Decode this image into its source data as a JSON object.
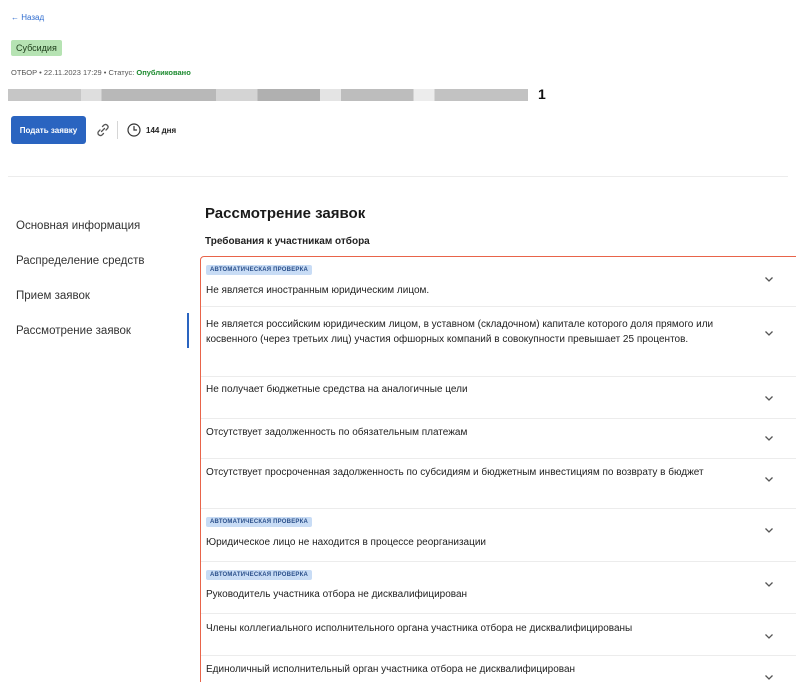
{
  "header": {
    "back_label": "← Назад",
    "badge": "Субсидия",
    "meta_prefix": "ОТБОР • 22.11.2023 17:29 • Статус: ",
    "status_value": "Опубликовано",
    "title_suffix": "1",
    "apply_label": "Подать заявку",
    "days_label": "144 дня"
  },
  "sidebar": {
    "items": [
      {
        "label": "Основная информация"
      },
      {
        "label": "Распределение средств"
      },
      {
        "label": "Прием заявок"
      },
      {
        "label": "Рассмотрение заявок"
      }
    ]
  },
  "main": {
    "section_title": "Рассмотрение заявок",
    "sub_title": "Требования к участникам отбора",
    "auto_tag": "АВТОМАТИЧЕСКАЯ ПРОВЕРКА",
    "requirements": [
      {
        "text": "Не является иностранным юридическим лицом.",
        "auto": true
      },
      {
        "text": "Не является российским юридическим лицом, в уставном (складочном) капитале которого доля прямого или косвенного (через третьих лиц) участия офшорных компаний в совокупности превышает 25 процентов.",
        "auto": false
      },
      {
        "text": "Не получает бюджетные средства на аналогичные цели",
        "auto": false
      },
      {
        "text": "Отсутствует задолженность по обязательным платежам",
        "auto": false
      },
      {
        "text": "Отсутствует просроченная задолженность по субсидиям и бюджетным инвестициям по возврату в бюджет",
        "auto": false
      },
      {
        "text": "Юридическое лицо не находится в процессе реорганизации",
        "auto": true
      },
      {
        "text": "Руководитель участника отбора не дисквалифицирован",
        "auto": true
      },
      {
        "text": "Члены коллегиального исполнительного органа участника отбора не дисквалифицированы",
        "auto": false
      },
      {
        "text": "Единоличный исполнительный орган участника отбора не дисквалифицирован",
        "auto": false
      }
    ]
  },
  "colors": {
    "accent": "#2a64c0",
    "badge_bg": "#b6e3b3",
    "status_green": "#1b8a2e",
    "highlight_border": "#e8644a",
    "auto_tag_bg": "#c8dcf5"
  }
}
